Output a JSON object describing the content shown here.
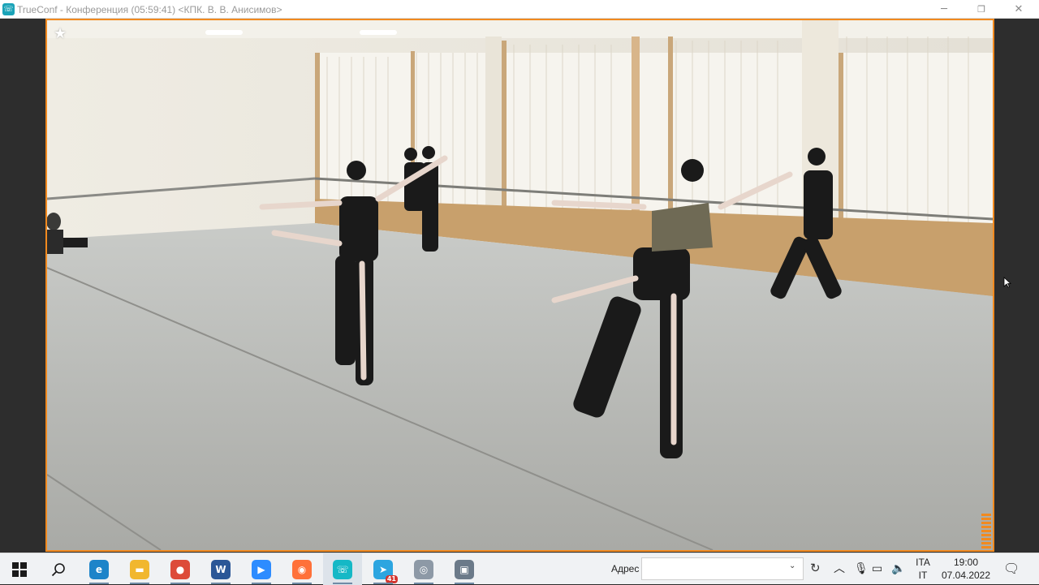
{
  "window": {
    "app_icon": "trueconf-icon",
    "title": "TrueConf - Конференция (05:59:41) <КПК. В. В. Анисимов>",
    "controls": [
      "minimize",
      "maximize",
      "close"
    ]
  },
  "video": {
    "favorite_icon": "star-icon",
    "border_color": "#f28a1f",
    "audio_level_bars": 9
  },
  "taskbar": {
    "start_icon": "windows-logo-icon",
    "search_icon": "search-icon",
    "apps": [
      {
        "name": "edge",
        "glyph": "e",
        "color": "#1d84c9"
      },
      {
        "name": "file-explorer",
        "glyph": "▬",
        "color": "#f1b72e"
      },
      {
        "name": "chrome",
        "glyph": "●",
        "color": "#dd4b39"
      },
      {
        "name": "word",
        "glyph": "W",
        "color": "#2b5797"
      },
      {
        "name": "zoom",
        "glyph": "▶",
        "color": "#2d8cff"
      },
      {
        "name": "firefox",
        "glyph": "◉",
        "color": "#ff7139"
      },
      {
        "name": "trueconf",
        "glyph": "☏",
        "color": "#15b8c6"
      },
      {
        "name": "telegram",
        "glyph": "➤",
        "color": "#2ca5e0",
        "badge": "41"
      },
      {
        "name": "media-app",
        "glyph": "◎",
        "color": "#8d99a6"
      },
      {
        "name": "camera-app",
        "glyph": "▣",
        "color": "#6b7a89"
      }
    ],
    "address": {
      "label": "Адрес",
      "value": "",
      "placeholder": ""
    },
    "tray_icons": [
      "chevron-up-icon",
      "microphone-icon",
      "network-icon",
      "volume-icon"
    ],
    "language": {
      "line1": "ITA",
      "line2": "IT"
    },
    "clock": {
      "time": "19:00",
      "date": "07.04.2022"
    },
    "notification_icon": "action-center-icon"
  }
}
